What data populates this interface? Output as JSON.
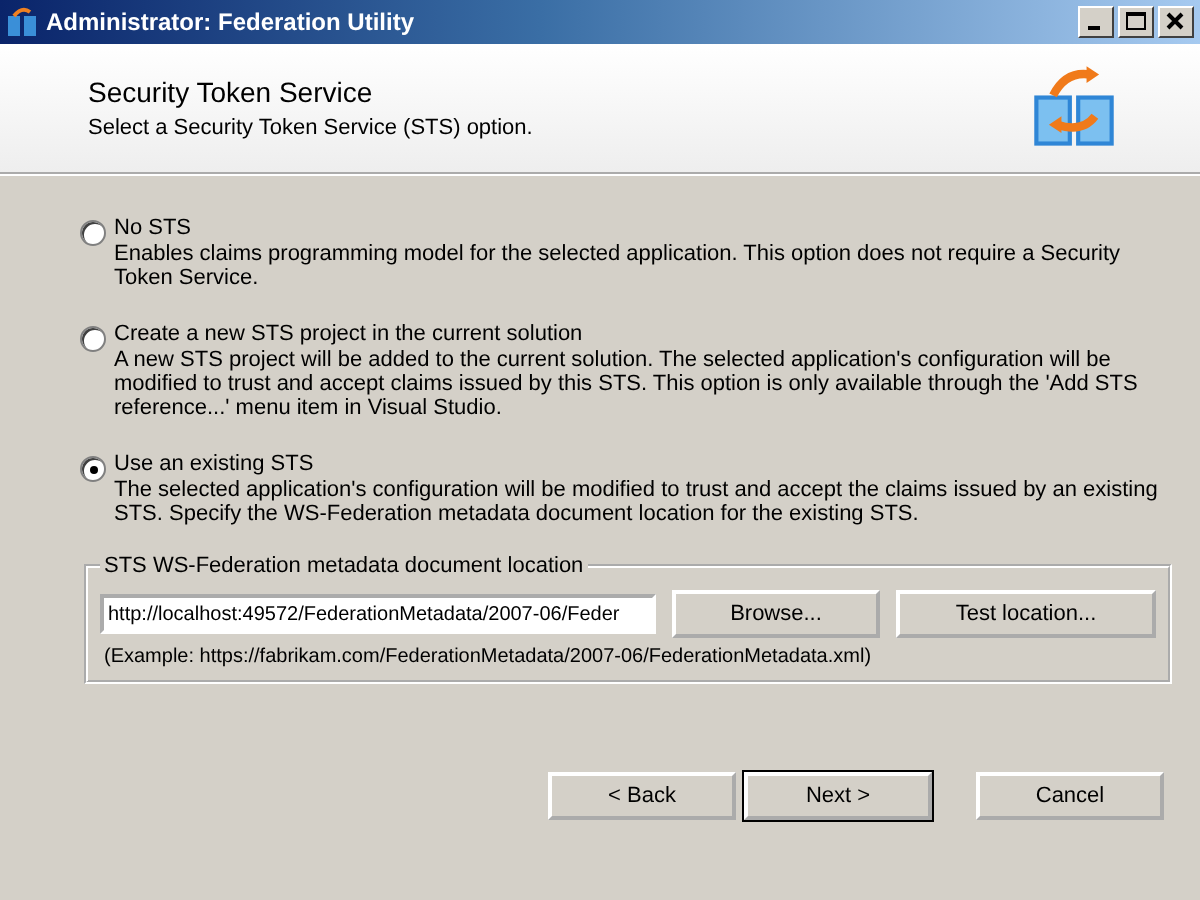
{
  "window": {
    "title": "Administrator: Federation Utility"
  },
  "header": {
    "title": "Security Token Service",
    "subtitle": "Select a Security Token Service (STS) option."
  },
  "options": [
    {
      "label": "No STS",
      "description": "Enables claims programming model for the selected application. This option does not require a Security Token Service.",
      "selected": false
    },
    {
      "label": "Create a new STS project in the current solution",
      "description": "A new STS project will be added to the current solution. The selected application's configuration will be modified to trust and accept claims issued by this STS. This option is only available through the 'Add STS reference...' menu item in Visual Studio.",
      "selected": false
    },
    {
      "label": "Use an existing STS",
      "description": "The selected application's configuration will be modified to trust and accept the claims issued by an existing STS. Specify the WS-Federation metadata document location for the existing STS.",
      "selected": true
    }
  ],
  "location_group": {
    "title": "STS WS-Federation metadata document location",
    "value": "http://localhost:49572/FederationMetadata/2007-06/Feder",
    "buttons": [
      "Browse...",
      "Test location..."
    ],
    "example": "(Example: https://fabrikam.com/FederationMetadata/2007-06/FederationMetadata.xml)"
  },
  "buttons": [
    {
      "label": "< Back",
      "default": false
    },
    {
      "label": "Next >",
      "default": true
    },
    {
      "label": "Cancel",
      "default": false
    }
  ]
}
